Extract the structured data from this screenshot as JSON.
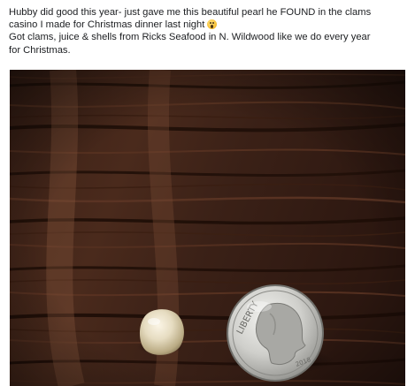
{
  "post": {
    "line1": "Hubby did good this year- just gave me this beautiful pearl he FOUND in the clams",
    "line2": "casino I made for Christmas dinner last night",
    "line2_emoji": "astonished-face-emoji",
    "line3": "Got clams, juice & shells from Ricks Seafood in N. Wildwood like we do every year",
    "line4": "for Christmas."
  },
  "photo": {
    "subject": "pearl-photo",
    "coin_inscriptions": {
      "liberty": "LIBERTY",
      "year": "2018"
    }
  }
}
